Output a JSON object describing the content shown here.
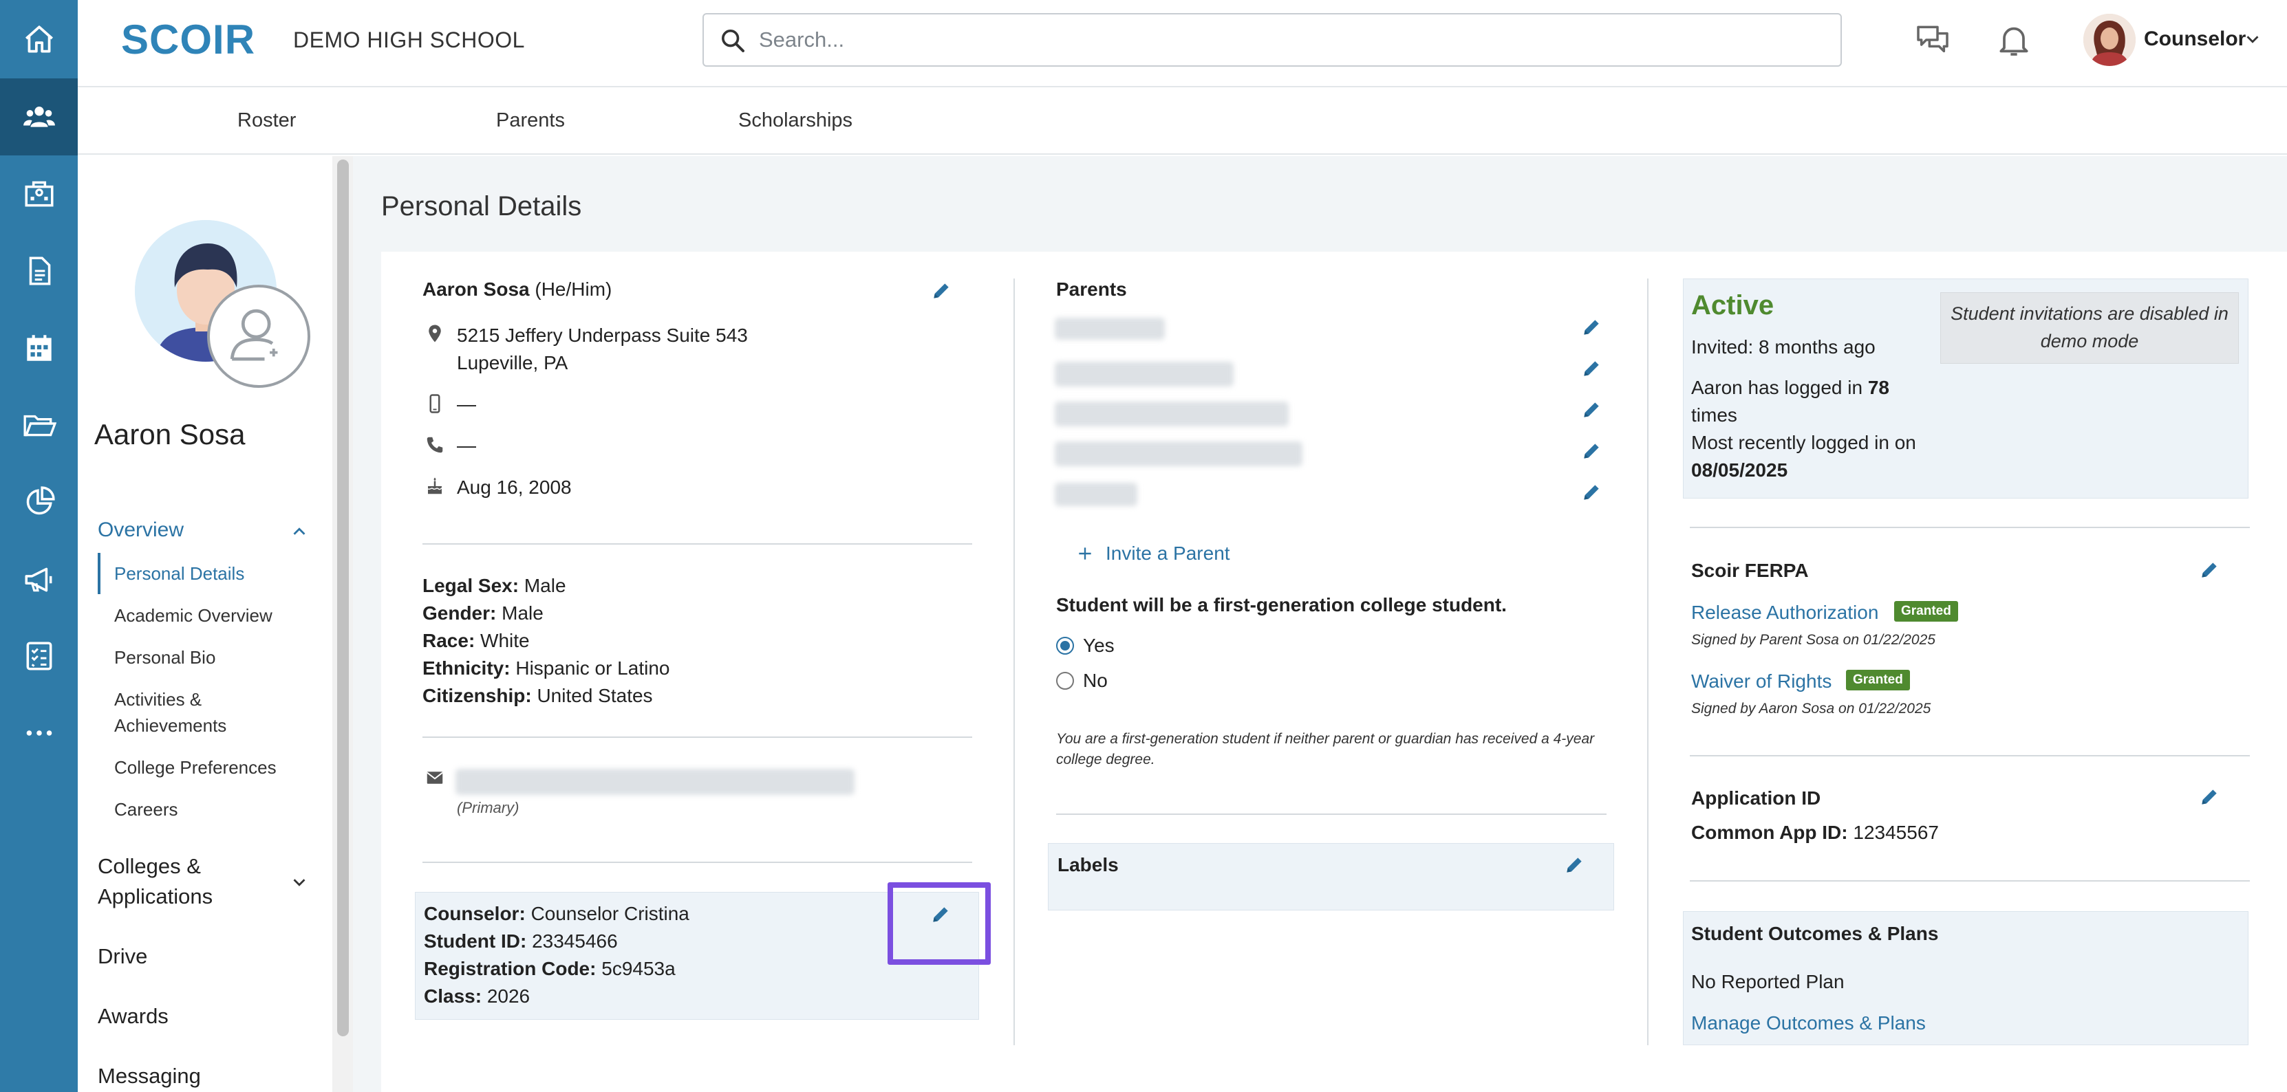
{
  "header": {
    "logo_text": "SCOIR",
    "school_name": "DEMO HIGH SCHOOL",
    "search_placeholder": "Search...",
    "user_label": "Counselor"
  },
  "subnav": [
    "Roster",
    "Parents",
    "Scholarships"
  ],
  "sidebar": {
    "student_name": "Aaron Sosa",
    "overview_label": "Overview",
    "overview_items": [
      "Personal Details",
      "Academic Overview",
      "Personal Bio",
      "Activities &",
      "Achievements",
      "College Preferences",
      "Careers"
    ],
    "colleges_label_1": "Colleges &",
    "colleges_label_2": "Applications",
    "drive_label": "Drive",
    "awards_label": "Awards",
    "messaging_label": "Messaging"
  },
  "page_title": "Personal Details",
  "contact": {
    "name": "Aaron Sosa",
    "pronouns": "(He/Him)",
    "address_line1": "5215 Jeffery Underpass Suite 543",
    "address_line2": "Lupeville, PA",
    "mobile": "—",
    "phone": "—",
    "birthday": "Aug 16, 2008"
  },
  "demographics": [
    {
      "label": "Legal Sex:",
      "value": "Male"
    },
    {
      "label": "Gender:",
      "value": "Male"
    },
    {
      "label": "Race:",
      "value": "White"
    },
    {
      "label": "Ethnicity:",
      "value": "Hispanic or Latino"
    },
    {
      "label": "Citizenship:",
      "value": "United States"
    }
  ],
  "email": {
    "type": "(Primary)"
  },
  "school_info": [
    {
      "label": "Counselor:",
      "value": "Counselor Cristina"
    },
    {
      "label": "Student ID:",
      "value": "23345466"
    },
    {
      "label": "Registration Code:",
      "value": "5c9453a"
    },
    {
      "label": "Class:",
      "value": "2026"
    }
  ],
  "parents": {
    "heading": "Parents",
    "invite_label": "Invite a Parent",
    "first_gen_question": "Student will be a first-generation college student.",
    "yes_label": "Yes",
    "no_label": "No",
    "selected": "Yes",
    "first_gen_note_1": "You are a first-generation student if neither parent or guardian has received a 4-year",
    "first_gen_note_2": "college degree."
  },
  "labels": {
    "heading": "Labels"
  },
  "status": {
    "state": "Active",
    "invited": "Invited: 8 months ago",
    "login_prefix": "Aaron has logged in",
    "login_count": "78",
    "login_suffix": "times",
    "recent_label": "Most recently logged in on",
    "recent_date": "08/05/2025",
    "demo_note": "Student invitations are disabled in demo mode"
  },
  "ferpa": {
    "heading": "Scoir FERPA",
    "items": [
      {
        "label": "Release Authorization",
        "badge": "Granted",
        "signed": "Signed by Parent Sosa on 01/22/2025"
      },
      {
        "label": "Waiver of Rights",
        "badge": "Granted",
        "signed": "Signed by Aaron Sosa on 01/22/2025"
      }
    ]
  },
  "application": {
    "heading": "Application ID",
    "label": "Common App ID:",
    "value": "12345567"
  },
  "outcomes": {
    "heading": "Student Outcomes & Plans",
    "status": "No Reported Plan",
    "link": "Manage Outcomes & Plans"
  },
  "colors": {
    "rail": "#2f7ba8",
    "rail_active": "#1c5578",
    "accent": "#2b73a4",
    "active_green": "#4f8a2f",
    "highlight": "#7b4fe0"
  }
}
